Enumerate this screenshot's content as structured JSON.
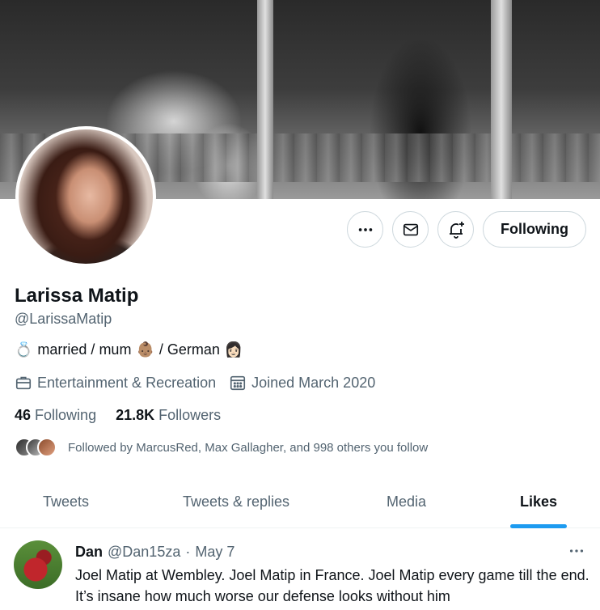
{
  "profile": {
    "name": "Larissa Matip",
    "handle": "@LarissaMatip",
    "bio": {
      "ring_emoji": "💍",
      "text_part1": "married / mum",
      "baby_emoji": "👶🏽",
      "text_part2": "/ German",
      "woman_emoji": "👩🏻"
    },
    "category": "Entertainment & Recreation",
    "joined": "Joined March 2020",
    "following_count": "46",
    "following_label": "Following",
    "followers_count": "21.8K",
    "followers_label": "Followers",
    "followed_by": "Followed by MarcusRed, Max Gallagher, and 998 others you follow"
  },
  "actions": {
    "more_icon": "more-icon",
    "message_icon": "mail-icon",
    "notify_icon": "bell-plus-icon",
    "following_button": "Following"
  },
  "tabs": [
    {
      "label": "Tweets",
      "active": false
    },
    {
      "label": "Tweets & replies",
      "active": false
    },
    {
      "label": "Media",
      "active": false
    },
    {
      "label": "Likes",
      "active": true
    }
  ],
  "tweet": {
    "display_name": "Dan",
    "handle": "@Dan15za",
    "separator": "·",
    "date": "May 7",
    "text": "Joel Matip at Wembley. Joel Matip in France. Joel Matip every game till the end. It’s insane how much worse our defense looks without him"
  },
  "colors": {
    "accent": "#1d9bf0",
    "text_primary": "#0f1419",
    "text_secondary": "#536471",
    "border": "#cfd9de"
  }
}
